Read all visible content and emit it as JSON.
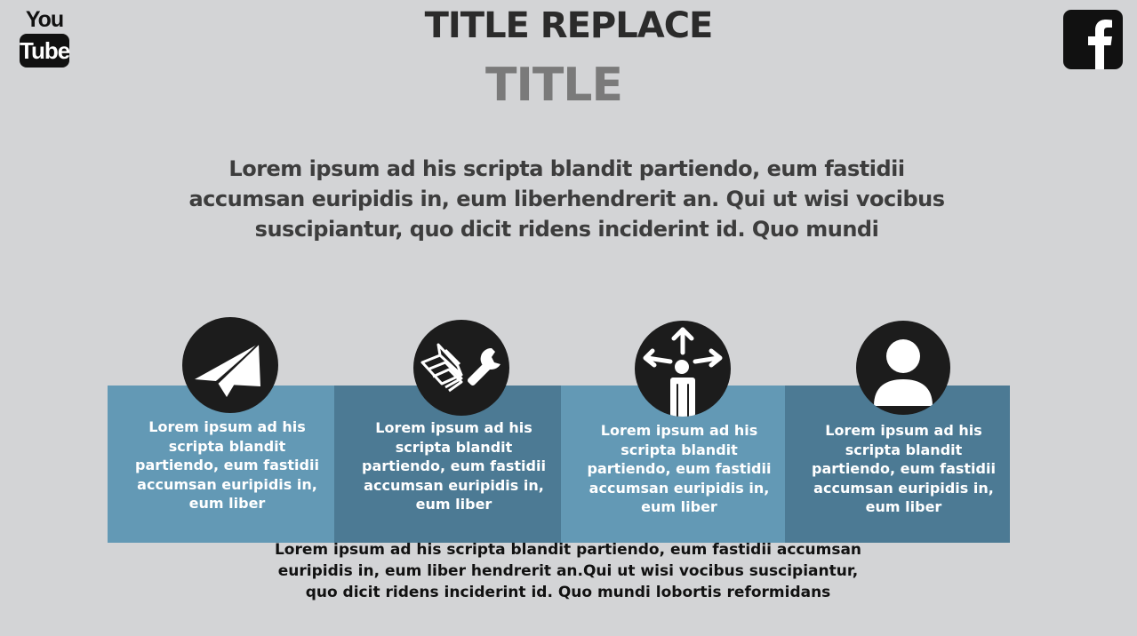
{
  "logos": {
    "youtube_top": "You",
    "youtube_bottom": "Tube"
  },
  "header": {
    "title": "TITLE REPLACE",
    "subtitle": "TITLE"
  },
  "intro": {
    "text": "Lorem ipsum ad his scripta blandit partiendo, eum fastidii accumsan euripidis  in, eum liberhendrerit an. Qui ut wisi vocibus suscipiantur, quo dicit ridens inciderint id. Quo mundi"
  },
  "features": [
    {
      "icon": "paper-plane-icon",
      "text": "Lorem ipsum ad his scripta blandit partiendo, eum fastidii accumsan euripidis  in, eum liber",
      "color": "#6399b5"
    },
    {
      "icon": "book-wrench-icon",
      "text": "Lorem ipsum ad his scripta blandit partiendo, eum fastidii accumsan euripidis  in, eum liber",
      "color": "#4c7a94"
    },
    {
      "icon": "person-directions-icon",
      "text": "Lorem ipsum ad his scripta blandit partiendo, eum fastidii accumsan euripidis  in, eum liber",
      "color": "#6399b5"
    },
    {
      "icon": "user-icon",
      "text": "Lorem ipsum ad his scripta blandit partiendo, eum fastidii accumsan euripidis  in, eum liber",
      "color": "#4c7a94"
    }
  ],
  "footer": {
    "text": "Lorem ipsum ad his scripta blandit partiendo, eum fastidii accumsan euripidis  in, eum liber hendrerit an.Qui ut wisi vocibus suscipiantur, quo dicit ridens inciderint id. Quo mundi lobortis reformidans"
  },
  "colors": {
    "background": "#d3d4d6",
    "panel_light": "#6399b5",
    "panel_dark": "#4c7a94",
    "icon_circle": "#1c1c1c"
  }
}
